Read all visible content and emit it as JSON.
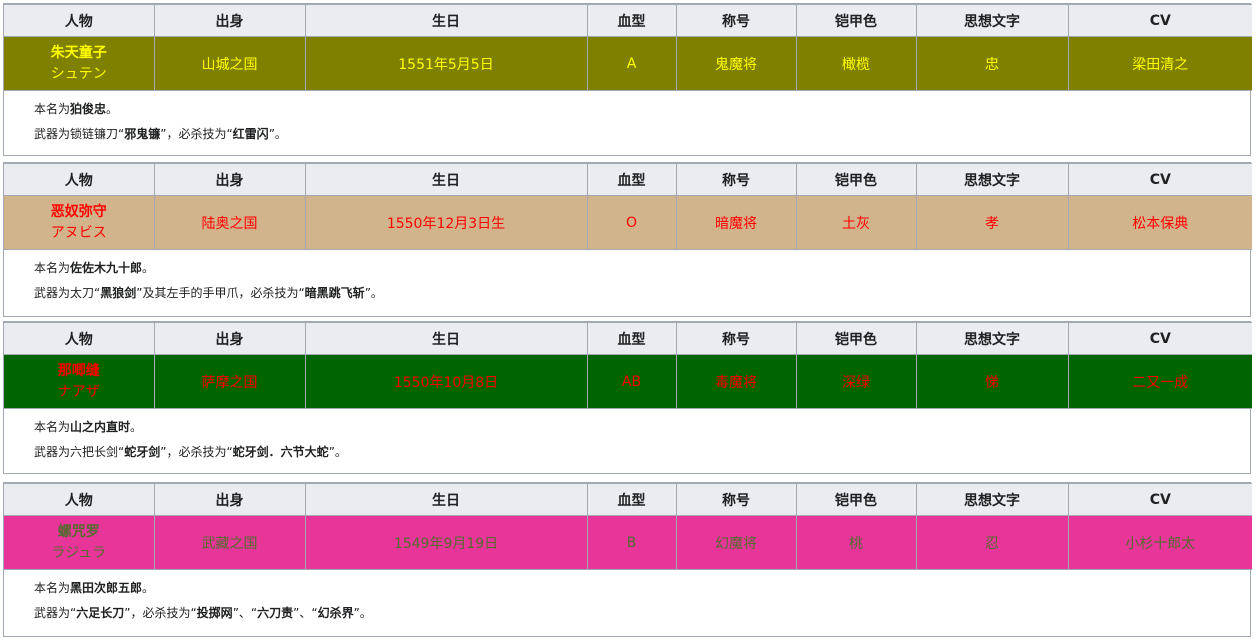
{
  "headers": [
    "人物",
    "出身",
    "生日",
    "血型",
    "称号",
    "铠甲色",
    "思想文字",
    "CV"
  ],
  "characters": [
    {
      "name": "朱天童子",
      "kana": "シュテン",
      "origin": "山城之国",
      "birthday": "1551年5月5日",
      "blood": "A",
      "title": "鬼魔将",
      "armor": "橄榄",
      "virtue": "忠",
      "cv": "梁田清之",
      "bg": "#808000",
      "fg": "#ffff00",
      "real_prefix": "本名为",
      "real_name": "狛俊忠",
      "real_suffix": "。",
      "weapon_parts": [
        {
          "t": "武器为锁链镰刀“",
          "b": false
        },
        {
          "t": "邪鬼镰",
          "b": true
        },
        {
          "t": "”，必杀技为“",
          "b": false
        },
        {
          "t": "红雷闪",
          "b": true
        },
        {
          "t": "”。",
          "b": false
        }
      ]
    },
    {
      "name": "恶奴弥守",
      "kana": "アヌビス",
      "origin": "陆奥之国",
      "birthday": "1550年12月3日生",
      "blood": "O",
      "title": "暗魔将",
      "armor": "土灰",
      "virtue": "孝",
      "cv": "松本保典",
      "bg": "#d2b48c",
      "fg": "#ff0000",
      "real_prefix": "本名为",
      "real_name": "佐佐木九十郎",
      "real_suffix": "。",
      "weapon_parts": [
        {
          "t": "武器为太刀“",
          "b": false
        },
        {
          "t": "黑狼剑",
          "b": true
        },
        {
          "t": "”及其左手的手甲爪，必杀技为“",
          "b": false
        },
        {
          "t": "暗黑跳飞斩",
          "b": true
        },
        {
          "t": "”。",
          "b": false
        }
      ]
    },
    {
      "name": "那唧缝",
      "kana": "ナアザ",
      "origin": "萨摩之国",
      "birthday": "1550年10月8日",
      "blood": "AB",
      "title": "毒魔将",
      "armor": "深绿",
      "virtue": "悌",
      "cv": "二又一成",
      "bg": "#006400",
      "fg": "#ff0000",
      "real_prefix": "本名为",
      "real_name": "山之内直时",
      "real_suffix": "。",
      "weapon_parts": [
        {
          "t": "武器为六把长剑“",
          "b": false
        },
        {
          "t": "蛇牙剑",
          "b": true
        },
        {
          "t": "”，必杀技为“",
          "b": false
        },
        {
          "t": "蛇牙剑．六节大蛇",
          "b": true
        },
        {
          "t": "”。",
          "b": false
        }
      ]
    },
    {
      "name": "螺咒罗",
      "kana": "ラジュラ",
      "origin": "武藏之国",
      "birthday": "1549年9月19日",
      "blood": "B",
      "title": "幻魔将",
      "armor": "桃",
      "virtue": "忍",
      "cv": "小杉十郎太",
      "bg": "#e8359a",
      "fg": "#556b2f",
      "real_prefix": "本名为",
      "real_name": "黑田次郎五郎",
      "real_suffix": "。",
      "weapon_parts": [
        {
          "t": "武器为“",
          "b": false
        },
        {
          "t": "六足长刀",
          "b": true
        },
        {
          "t": "”，必杀技为“",
          "b": false
        },
        {
          "t": "投掷网",
          "b": true
        },
        {
          "t": "”、“",
          "b": false
        },
        {
          "t": "六刀责",
          "b": true
        },
        {
          "t": "”、“",
          "b": false
        },
        {
          "t": "幻杀界",
          "b": true
        },
        {
          "t": "”。",
          "b": false
        }
      ]
    }
  ]
}
